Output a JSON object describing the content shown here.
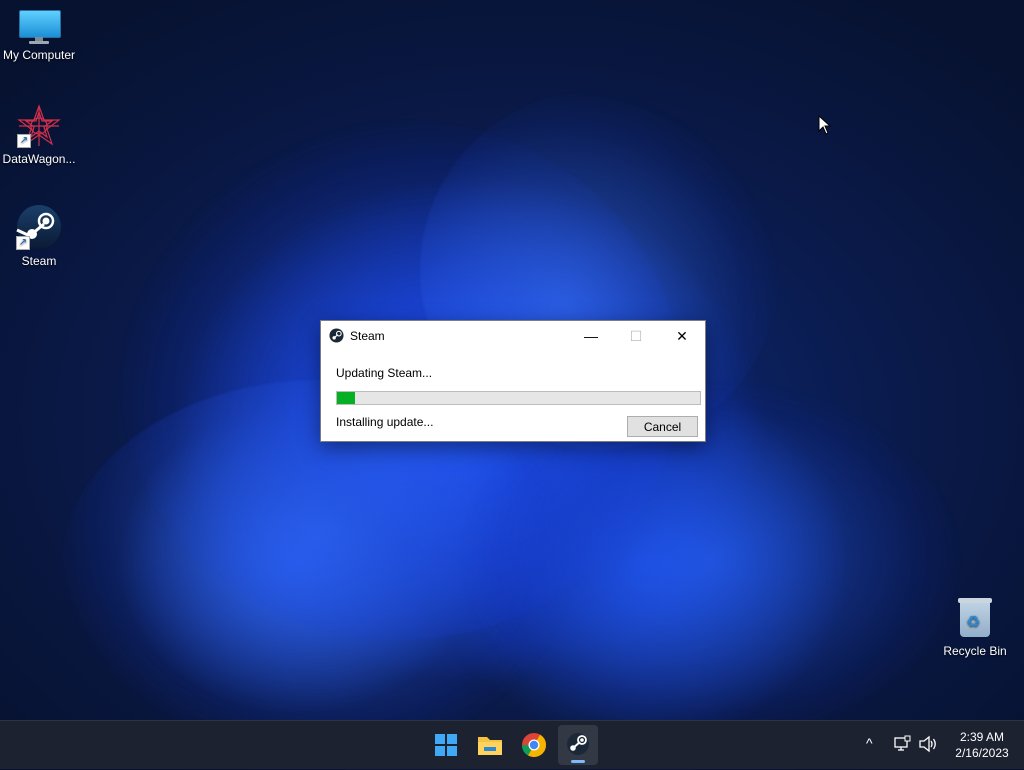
{
  "desktop": {
    "icons": [
      {
        "label": "My Computer"
      },
      {
        "label": "DataWagon..."
      },
      {
        "label": "Steam"
      },
      {
        "label": "Recycle Bin"
      }
    ]
  },
  "dialog": {
    "title": "Steam",
    "message": "Updating Steam...",
    "progress_fraction": 0.05,
    "status": "Installing update...",
    "cancel_label": "Cancel",
    "minimize_glyph": "—",
    "maximize_glyph": "☐",
    "close_glyph": "✕"
  },
  "taskbar": {
    "apps": [
      "start-icon",
      "file-explorer-icon",
      "chrome-icon",
      "steam-icon"
    ],
    "active_app": "steam-icon",
    "tray": {
      "chevron": "^",
      "time": "2:39 AM",
      "date": "2/16/2023"
    }
  },
  "colors": {
    "progress_fill": "#06b025",
    "taskbar_bg": "#1c2230",
    "accent": "#7fb8ff"
  }
}
